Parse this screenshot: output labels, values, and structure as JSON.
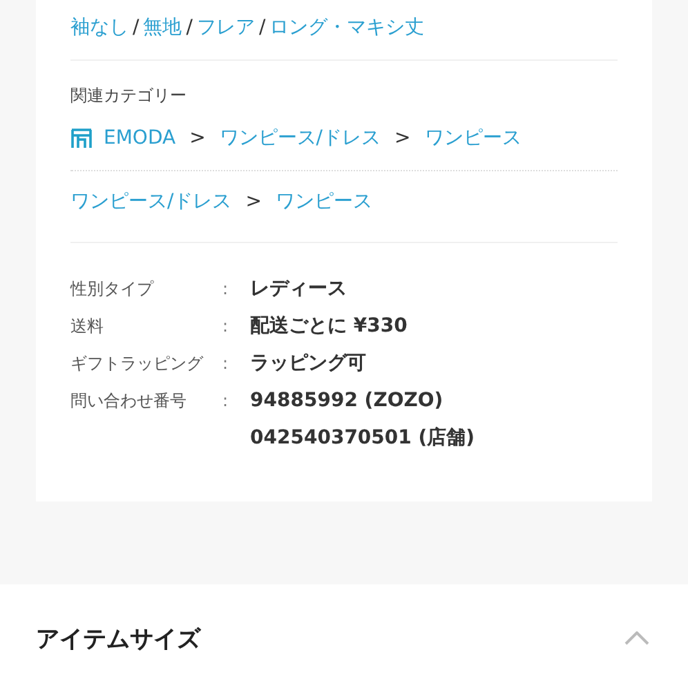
{
  "tags": {
    "separator": "/",
    "items": [
      "袖なし",
      "無地",
      "フレア",
      "ロング・マキシ丈"
    ]
  },
  "related_categories": {
    "title": "関連カテゴリー",
    "separator": ">",
    "paths": [
      {
        "kind": "brand",
        "items": [
          "EMODA",
          "ワンピース/ドレス",
          "ワンピース"
        ]
      },
      {
        "kind": "category",
        "items": [
          "ワンピース/ドレス",
          "ワンピース"
        ]
      }
    ]
  },
  "details": {
    "separator": ":",
    "rows": [
      {
        "label": "性別タイプ",
        "values": [
          "レディース"
        ]
      },
      {
        "label": "送料",
        "values": [
          "配送ごとに ¥330"
        ]
      },
      {
        "label": "ギフトラッピング",
        "values": [
          "ラッピング可"
        ]
      },
      {
        "label": "問い合わせ番号",
        "values": [
          "94885992 (ZOZO)",
          "042540370501 (店舗)"
        ]
      }
    ]
  },
  "section": {
    "title": "アイテムサイズ",
    "expanded": true
  }
}
